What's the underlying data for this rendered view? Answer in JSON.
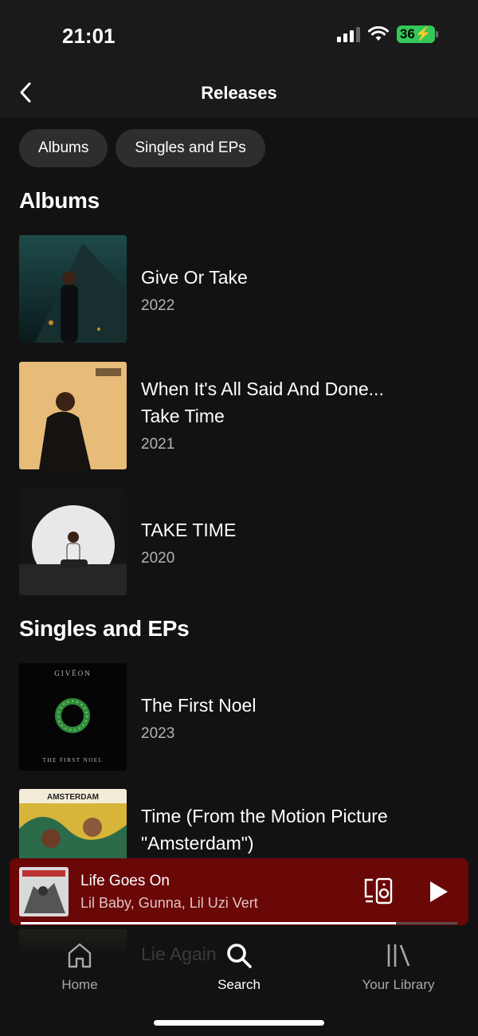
{
  "status_bar": {
    "time": "21:01",
    "battery": "36"
  },
  "header": {
    "title": "Releases",
    "back_icon": "chevron-left-icon"
  },
  "filters": [
    {
      "label": "Albums"
    },
    {
      "label": "Singles and EPs"
    }
  ],
  "sections": {
    "albums": {
      "title": "Albums",
      "items": [
        {
          "title": "Give Or Take",
          "year": "2022"
        },
        {
          "title_line1": "When It's All Said And Done...",
          "title_line2": "Take Time",
          "year": "2021"
        },
        {
          "title": "TAKE TIME",
          "year": "2020"
        }
      ]
    },
    "singles": {
      "title": "Singles and EPs",
      "items": [
        {
          "title": "The First Noel",
          "year": "2023",
          "cover_text_top": "GIVĒON",
          "cover_text_bottom": "THE FIRST NOEL"
        },
        {
          "title_line1": "Time (From the Motion Picture",
          "title_line2": "\"Amsterdam\")",
          "cover_text": "AMSTERDAM"
        },
        {
          "title": "Lie Again"
        }
      ]
    }
  },
  "now_playing": {
    "title": "Life Goes On",
    "artist": "Lil Baby, Gunna, Lil Uzi Vert",
    "progress": 0.86,
    "accent_color": "#6a0707"
  },
  "nav": [
    {
      "label": "Home",
      "icon": "home-icon"
    },
    {
      "label": "Search",
      "icon": "search-icon",
      "active": true
    },
    {
      "label": "Your Library",
      "icon": "library-icon"
    }
  ]
}
